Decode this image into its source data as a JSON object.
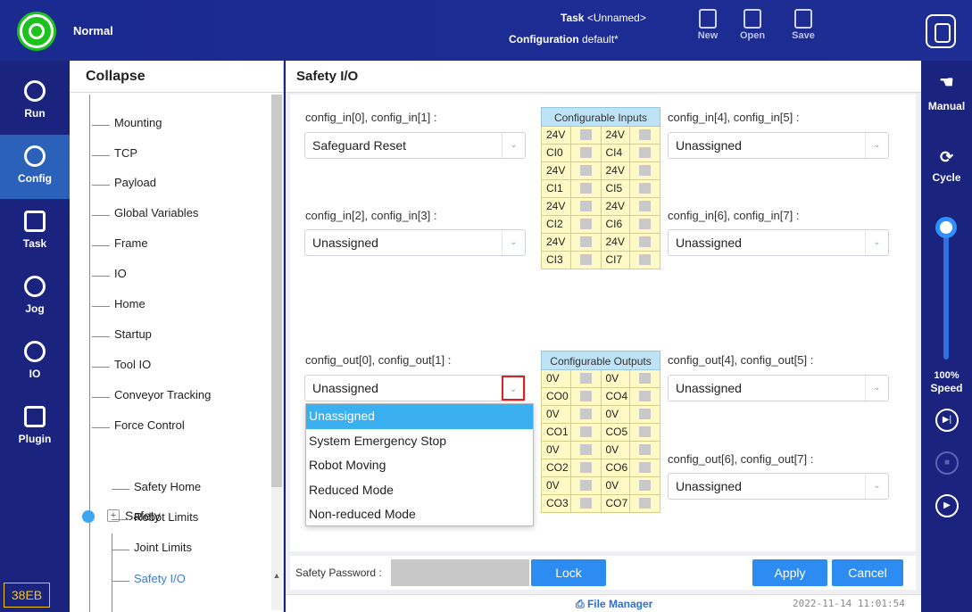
{
  "topbar": {
    "mode": "Normal",
    "task_label": "Task",
    "task_value": "<Unnamed>",
    "config_label": "Configuration",
    "config_value": "default*",
    "buttons": [
      "New",
      "Open",
      "Save"
    ]
  },
  "leftnav": {
    "items": [
      "Run",
      "Config",
      "Task",
      "Jog",
      "IO",
      "Plugin"
    ],
    "active": "Config",
    "serial": "38EB"
  },
  "tree": {
    "header": "Collapse",
    "items": [
      "Mounting",
      "TCP",
      "Payload",
      "Global Variables",
      "Frame",
      "IO",
      "Home",
      "Startup",
      "Tool IO",
      "Conveyor Tracking",
      "Force Control"
    ],
    "safety_label": "Safety",
    "safety_items": [
      "Safety Home",
      "Robot Limits",
      "Joint Limits",
      "Safety I/O"
    ]
  },
  "main": {
    "title": "Safety I/O",
    "in01_label": "config_in[0], config_in[1] :",
    "in01_value": "Safeguard Reset",
    "in23_label": "config_in[2], config_in[3] :",
    "in23_value": "Unassigned",
    "in45_label": "config_in[4], config_in[5] :",
    "in45_value": "Unassigned",
    "in67_label": "config_in[6], config_in[7] :",
    "in67_value": "Unassigned",
    "out01_label": "config_out[0], config_out[1] :",
    "out01_value": "Unassigned",
    "out45_label": "config_out[4], config_out[5] :",
    "out45_value": "Unassigned",
    "out67_label": "config_out[6], config_out[7] :",
    "out67_value": "Unassigned",
    "inputs_header": "Configurable Inputs",
    "inputs_rows": [
      [
        "24V",
        "24V"
      ],
      [
        "CI0",
        "CI4"
      ],
      [
        "24V",
        "24V"
      ],
      [
        "CI1",
        "CI5"
      ],
      [
        "24V",
        "24V"
      ],
      [
        "CI2",
        "CI6"
      ],
      [
        "24V",
        "24V"
      ],
      [
        "CI3",
        "CI7"
      ]
    ],
    "outputs_header": "Configurable Outputs",
    "outputs_rows": [
      [
        "0V",
        "0V"
      ],
      [
        "CO0",
        "CO4"
      ],
      [
        "0V",
        "0V"
      ],
      [
        "CO1",
        "CO5"
      ],
      [
        "0V",
        "0V"
      ],
      [
        "CO2",
        "CO6"
      ],
      [
        "0V",
        "0V"
      ],
      [
        "CO3",
        "CO7"
      ]
    ],
    "dropdown_options": [
      "Unassigned",
      "System Emergency Stop",
      "Robot Moving",
      "Reduced Mode",
      "Non-reduced Mode"
    ],
    "dropdown_highlight": "Unassigned",
    "password_label": "Safety Password :",
    "lock_label": "Lock",
    "apply_label": "Apply",
    "cancel_label": "Cancel"
  },
  "statusline": {
    "file_manager": "File Manager",
    "timestamp": "2022-11-14 11:01:54"
  },
  "rightbar": {
    "manual": "Manual",
    "cycle": "Cycle",
    "speed_value": "100%",
    "speed_label": "Speed"
  }
}
